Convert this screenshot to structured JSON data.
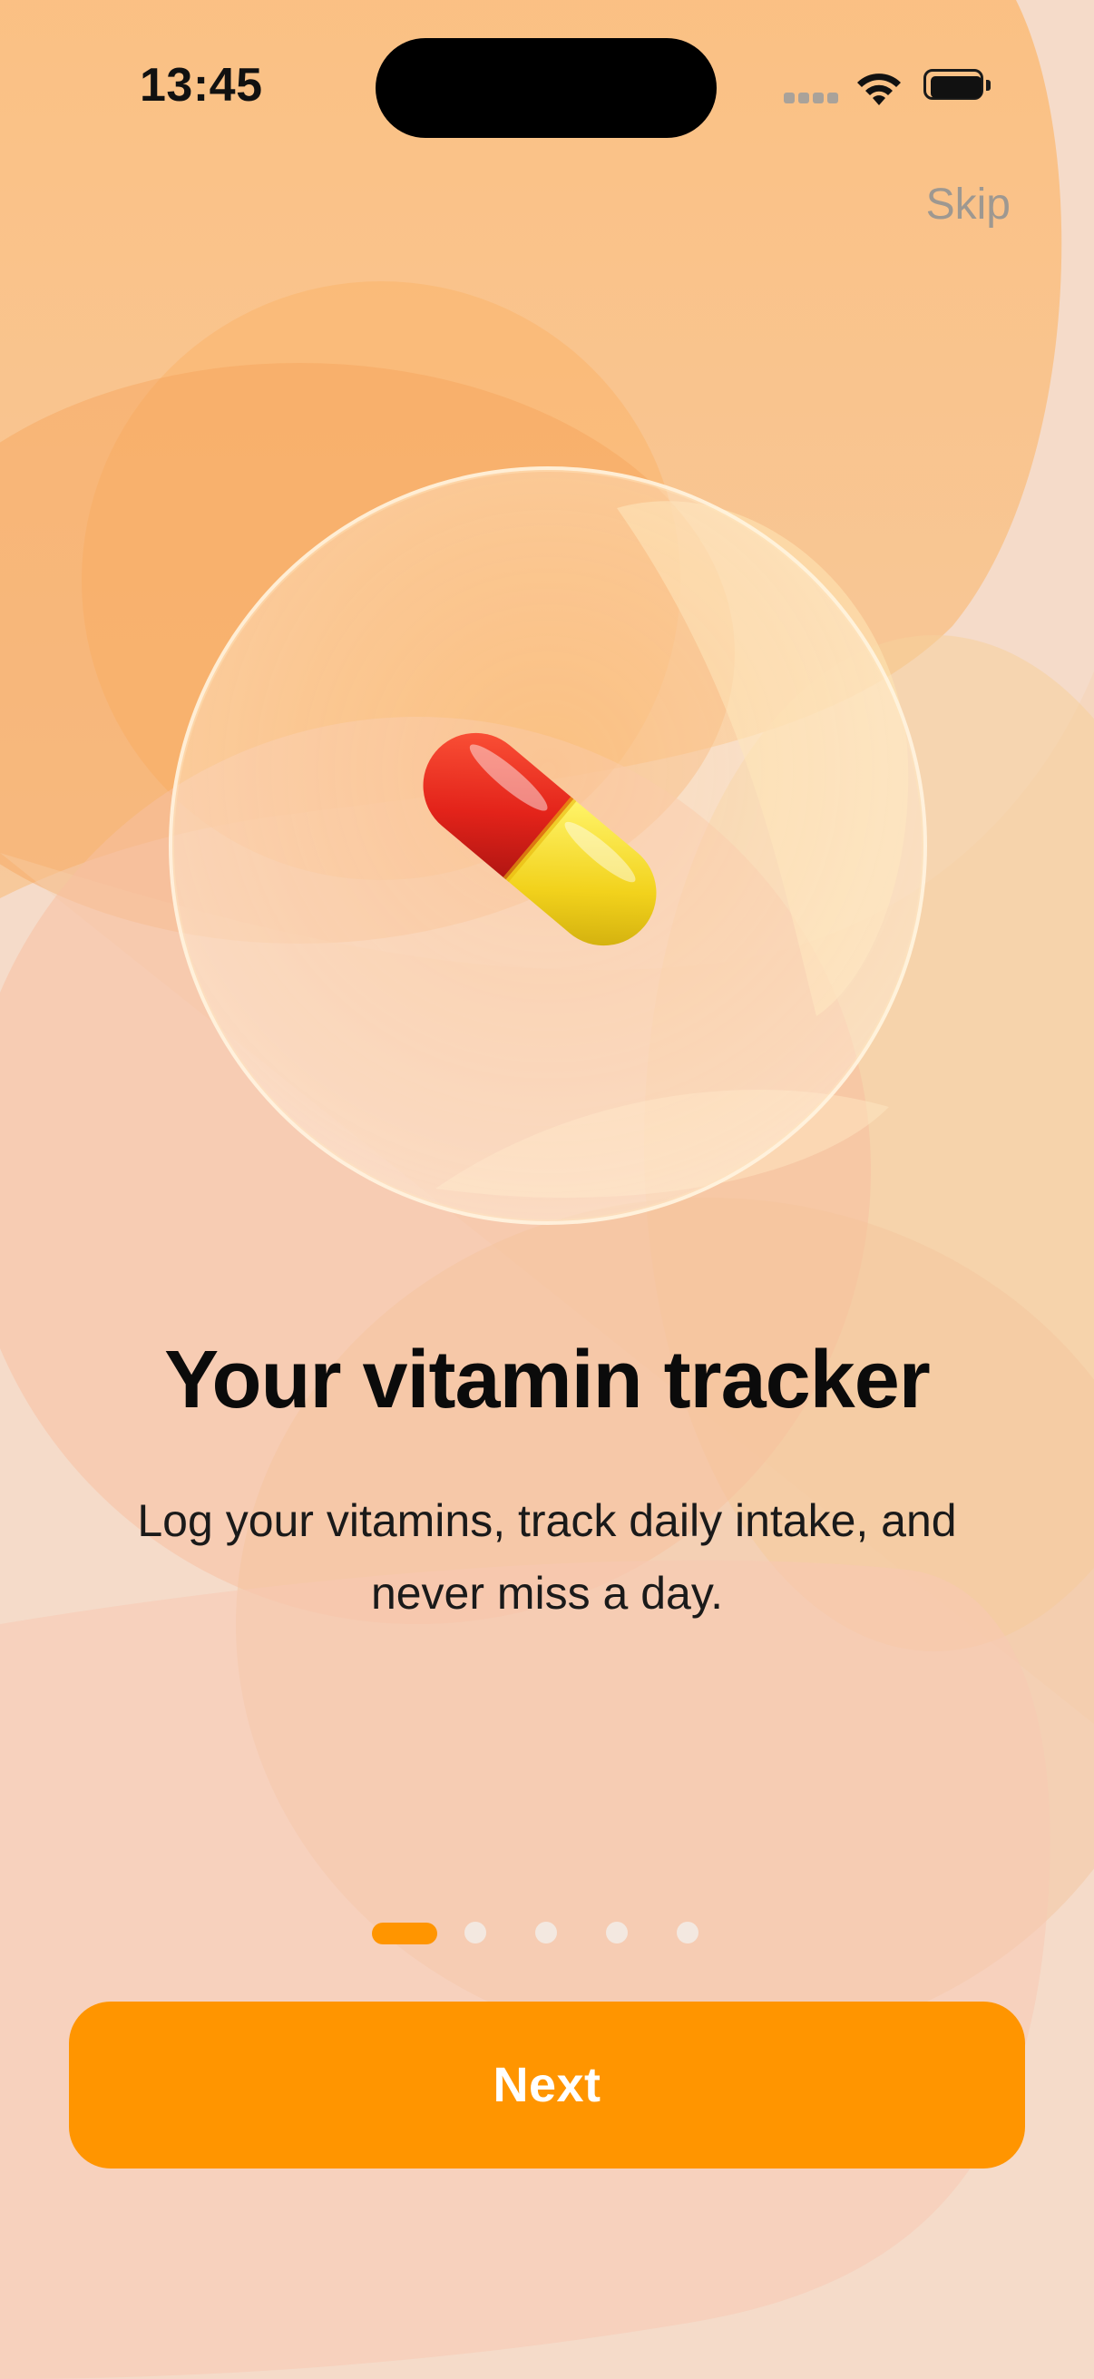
{
  "status_bar": {
    "time": "13:45",
    "signal_icon": "cellular-dots-icon",
    "wifi_icon": "wifi-icon",
    "battery_icon": "battery-full-icon"
  },
  "header": {
    "skip_label": "Skip"
  },
  "hero": {
    "icon": "pill-capsule-icon",
    "title": "Your vitamin tracker",
    "subtitle": "Log your vitamins, track daily intake, and never miss a day."
  },
  "pager": {
    "page_count": 5,
    "current_page": 1
  },
  "footer": {
    "next_label": "Next"
  },
  "colors": {
    "accent": "#ff9500",
    "background": "#f6e2d3",
    "muted_text": "#9e9891"
  }
}
